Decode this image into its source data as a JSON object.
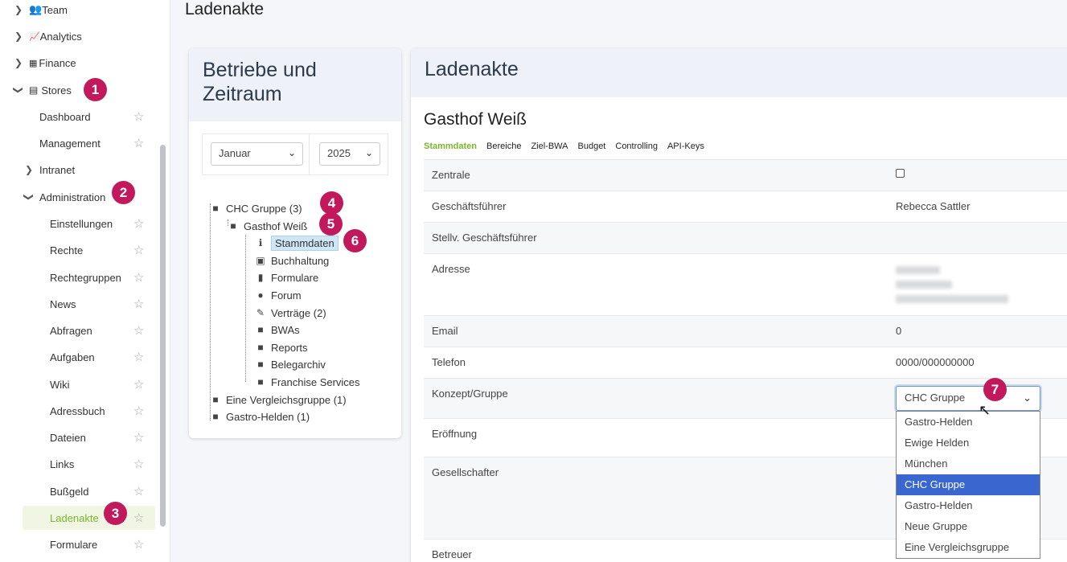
{
  "sidebar": {
    "items": [
      {
        "label": "Team",
        "icon": "users-icon"
      },
      {
        "label": "Analytics",
        "icon": "chart-icon"
      },
      {
        "label": "Finance",
        "icon": "calculator-icon"
      },
      {
        "label": "Stores",
        "icon": "store-icon"
      },
      {
        "label": "Dashboard"
      },
      {
        "label": "Management"
      },
      {
        "label": "Intranet"
      },
      {
        "label": "Administration"
      },
      {
        "label": "Einstellungen"
      },
      {
        "label": "Rechte"
      },
      {
        "label": "Rechtegruppen"
      },
      {
        "label": "News"
      },
      {
        "label": "Abfragen"
      },
      {
        "label": "Aufgaben"
      },
      {
        "label": "Wiki"
      },
      {
        "label": "Adressbuch"
      },
      {
        "label": "Dateien"
      },
      {
        "label": "Links"
      },
      {
        "label": "Bußgeld"
      },
      {
        "label": "Ladenakte"
      },
      {
        "label": "Formulare"
      }
    ]
  },
  "badges": [
    "1",
    "2",
    "3",
    "4",
    "5",
    "6",
    "7"
  ],
  "page": {
    "title": "Ladenakte"
  },
  "left_card": {
    "title": "Betriebe und Zeitraum",
    "month": "Januar",
    "year": "2025",
    "tree": [
      {
        "label": "CHC Gruppe (3)",
        "icon": "folder-icon"
      },
      {
        "label": "Gasthof Weiß",
        "icon": "folder-icon"
      },
      {
        "label": "Stammdaten",
        "icon": "info-icon"
      },
      {
        "label": "Buchhaltung",
        "icon": "money-icon"
      },
      {
        "label": "Formulare",
        "icon": "file-icon"
      },
      {
        "label": "Forum",
        "icon": "comments-icon"
      },
      {
        "label": "Verträge (2)",
        "icon": "signature-icon"
      },
      {
        "label": "BWAs",
        "icon": "folder-icon"
      },
      {
        "label": "Reports",
        "icon": "folder-icon"
      },
      {
        "label": "Belegarchiv",
        "icon": "folder-icon"
      },
      {
        "label": "Franchise Services",
        "icon": "folder-icon"
      },
      {
        "label": "Eine Vergleichsgruppe (1)",
        "icon": "folder-icon"
      },
      {
        "label": "Gastro-Helden (1)",
        "icon": "folder-icon"
      }
    ]
  },
  "right_card": {
    "title": "Ladenakte",
    "store_name": "Gasthof Weiß",
    "tabs": [
      "Stammdaten",
      "Bereiche",
      "Ziel-BWA",
      "Budget",
      "Controlling",
      "API-Keys"
    ],
    "fields": [
      {
        "label": "Zentrale",
        "value": ""
      },
      {
        "label": "Geschäftsführer",
        "value": "Rebecca Sattler"
      },
      {
        "label": "Stellv. Geschäftsführer",
        "value": ""
      },
      {
        "label": "Adresse",
        "value": ""
      },
      {
        "label": "Email",
        "value": "0"
      },
      {
        "label": "Telefon",
        "value": "0000/000000000"
      },
      {
        "label": "Konzept/Gruppe",
        "value": "CHC Gruppe"
      },
      {
        "label": "Eröffnung",
        "value": ""
      },
      {
        "label": "Gesellschafter",
        "value": ""
      },
      {
        "label": "Betreuer",
        "value": ""
      }
    ],
    "dropdown_options": [
      "Gastro-Helden",
      "Ewige Helden",
      "München",
      "CHC Gruppe",
      "Gastro-Helden",
      "Neue Gruppe",
      "Eine Vergleichsgruppe"
    ]
  },
  "colors": {
    "accent": "#7ab72a",
    "badge": "#c2195c",
    "selected_option": "#3a66d0"
  }
}
